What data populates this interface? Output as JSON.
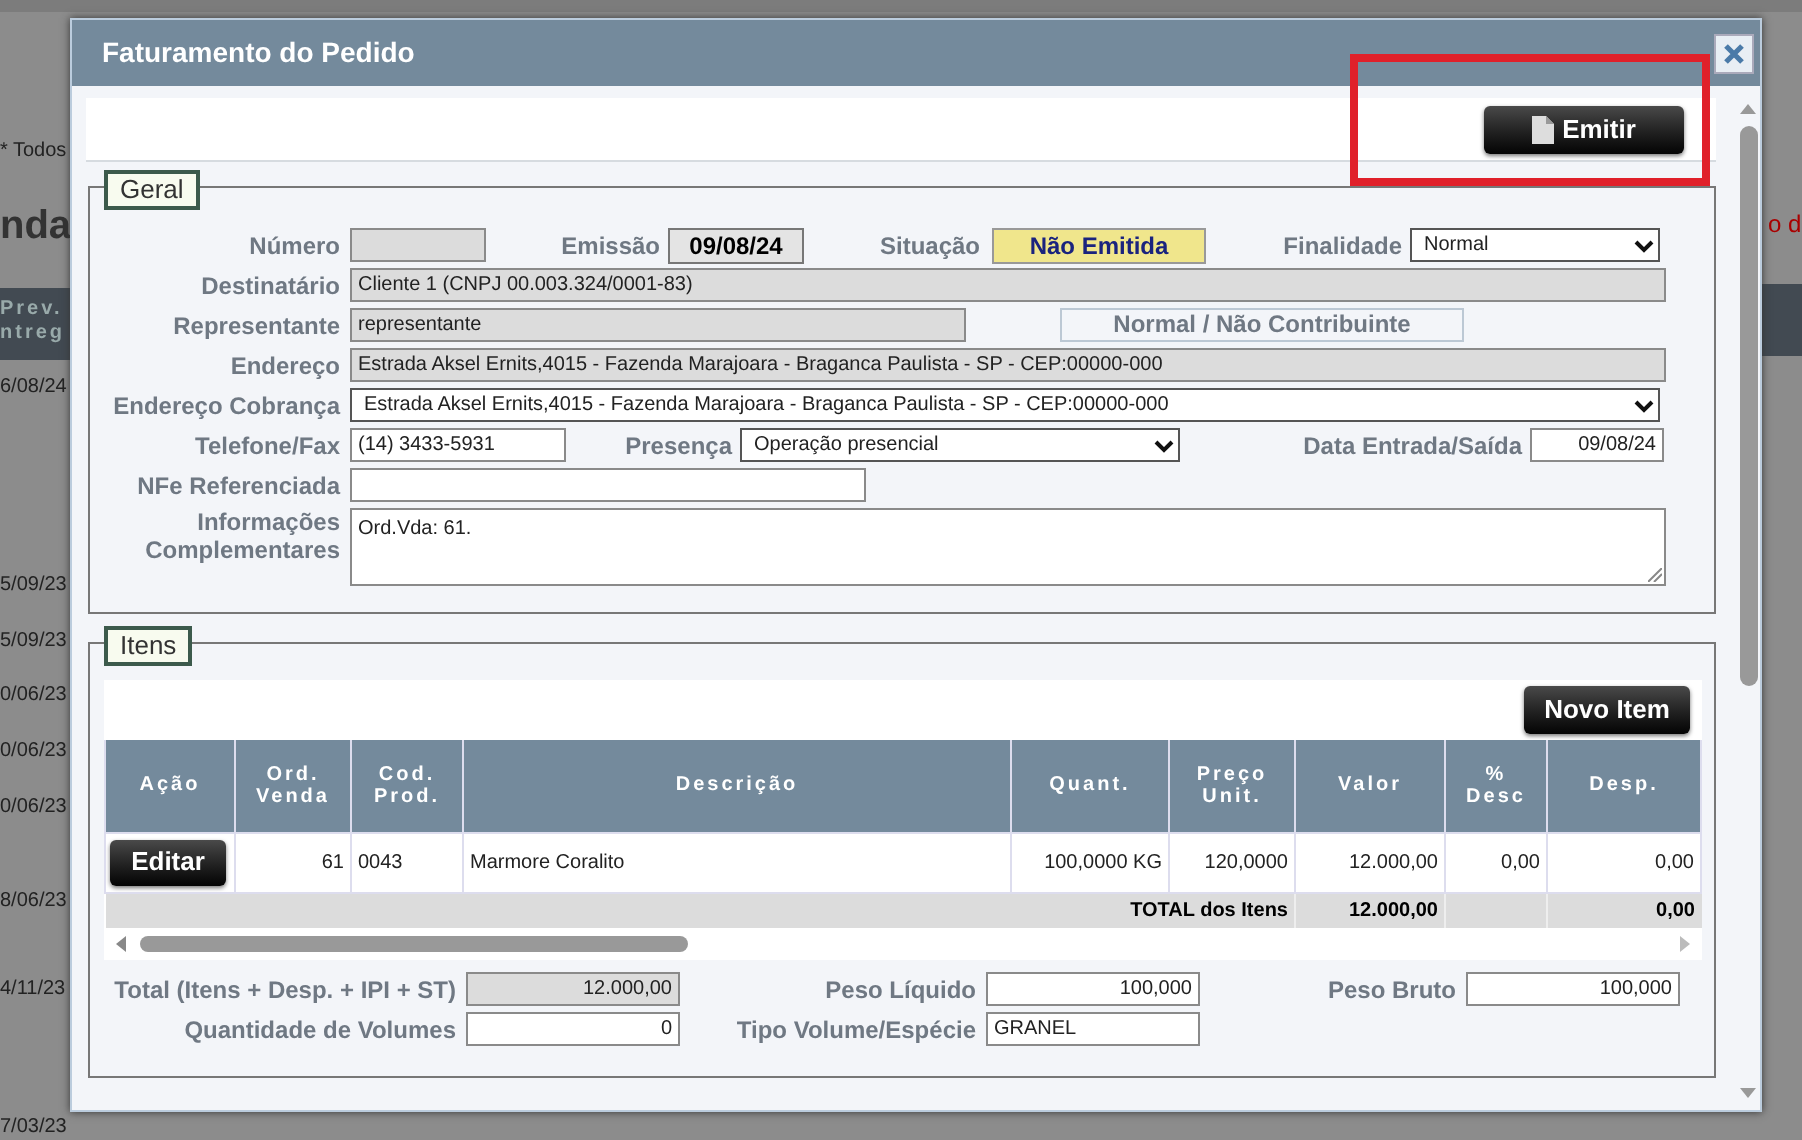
{
  "background": {
    "left_texts": [
      "* Todos",
      "nda",
      "Prev.",
      "ntreg",
      "6/08/24",
      "5/09/23",
      "5/09/23",
      "0/06/23",
      "0/06/23",
      "0/06/23",
      "8/06/23",
      "4/11/23",
      "7/03/23"
    ],
    "right_text": "o d"
  },
  "dialog": {
    "title": "Faturamento do Pedido",
    "emit_button": "Emitir",
    "geral": {
      "legend": "Geral",
      "numero": {
        "label": "Número"
      },
      "emissao": {
        "label": "Emissão",
        "value": "09/08/24"
      },
      "situacao": {
        "label": "Situação",
        "value": "Não Emitida"
      },
      "finalidade": {
        "label": "Finalidade",
        "value": "Normal"
      },
      "destinatario": {
        "label": "Destinatário",
        "value": "Cliente 1 (CNPJ 00.003.324/0001-83)"
      },
      "representante": {
        "label": "Representante",
        "value": "representante"
      },
      "contribuinte": "Normal / Não Contribuinte",
      "endereco": {
        "label": "Endereço",
        "value": "Estrada Aksel Ernits,4015  - Fazenda Marajoara - Braganca Paulista - SP - CEP:00000-000"
      },
      "endereco_cobranca": {
        "label": "Endereço Cobrança",
        "value": "Estrada Aksel Ernits,4015 - Fazenda Marajoara - Braganca Paulista - SP - CEP:00000-000"
      },
      "telefone": {
        "label": "Telefone/Fax",
        "value": "(14) 3433-5931"
      },
      "presenca": {
        "label": "Presença",
        "value": "Operação presencial"
      },
      "data_entrada": {
        "label": "Data Entrada/Saída",
        "value": "09/08/24"
      },
      "nfe": {
        "label": "NFe Referenciada"
      },
      "informacoes": {
        "label_lines": [
          "Informações",
          "Complementares"
        ],
        "value": "Ord.Vda: 61."
      }
    },
    "itens": {
      "legend": "Itens",
      "new_button": "Novo Item",
      "table": {
        "columns": [
          "Ação",
          "Ord. Venda",
          "Cod. Prod.",
          "Descrição",
          "Quant.",
          "Preço Unit.",
          "Valor",
          "% Desc",
          "Desp."
        ],
        "rows": [
          {
            "cells": [
              "Editar",
              "61",
              "0043",
              "Marmore Coralito",
              "100,0000 KG",
              "120,0000",
              "12.000,00",
              "0,00",
              "0,00"
            ]
          }
        ],
        "total_label": "TOTAL dos Itens",
        "total_valor": "12.000,00",
        "total_desp": "0,00"
      },
      "totals": {
        "total": {
          "label": "Total (Itens + Desp. + IPI + ST)",
          "value": "12.000,00"
        },
        "peso_liquido": {
          "label": "Peso Líquido",
          "value": "100,000"
        },
        "peso_bruto": {
          "label": "Peso Bruto",
          "value": "100,000"
        },
        "volumes": {
          "label": "Quantidade de Volumes",
          "value": "0"
        },
        "tipo_volume": {
          "label": "Tipo Volume/Espécie",
          "value": "GRANEL"
        }
      }
    }
  }
}
